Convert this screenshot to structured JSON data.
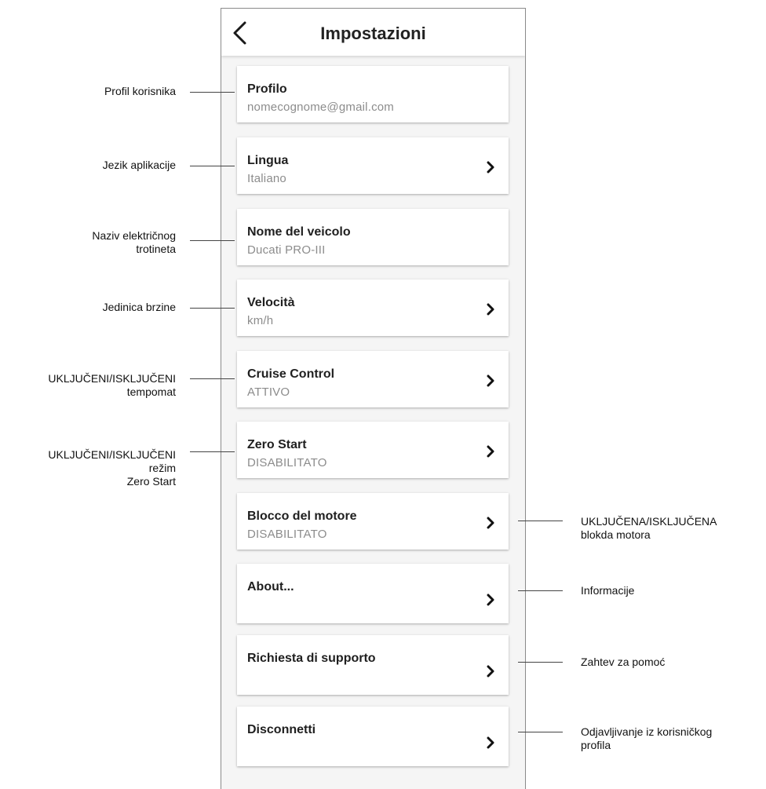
{
  "header": {
    "title": "Impostazioni"
  },
  "items": [
    {
      "title": "Profilo",
      "subtitle": "nomecognome@gmail.com",
      "chevron": false
    },
    {
      "title": "Lingua",
      "subtitle": "Italiano",
      "chevron": true
    },
    {
      "title": "Nome del veicolo",
      "subtitle": "Ducati PRO-III",
      "chevron": false
    },
    {
      "title": "Velocità",
      "subtitle": "km/h",
      "chevron": true
    },
    {
      "title": "Cruise Control",
      "subtitle": "ATTIVO",
      "chevron": true
    },
    {
      "title": "Zero Start",
      "subtitle": "DISABILITATO",
      "chevron": true
    },
    {
      "title": "Blocco del motore",
      "subtitle": "DISABILITATO",
      "chevron": true
    },
    {
      "title": "About...",
      "subtitle": "",
      "chevron": true
    },
    {
      "title": "Richiesta di supporto",
      "subtitle": "",
      "chevron": true
    },
    {
      "title": "Disconnetti",
      "subtitle": "",
      "chevron": true
    }
  ],
  "annotations": {
    "profile": [
      "Profil korisnika"
    ],
    "language": [
      "Jezik aplikacije"
    ],
    "vehicle_name": [
      "Naziv električnog",
      "trotineta"
    ],
    "speed_unit": [
      "Jedinica brzine"
    ],
    "cruise_control": [
      "UKLJUČENI/ISKLJUČENI",
      "tempomat"
    ],
    "zero_start": [
      "UKLJUČENI/ISKLJUČENI",
      "režim",
      "Zero Start"
    ],
    "motor_lock": [
      "UKLJUČENA/ISKLJUČENA",
      "blokda motora"
    ],
    "about": [
      "Informacije"
    ],
    "support": [
      "Zahtev za pomoć"
    ],
    "logout": [
      "Odjavljivanje iz korisničkog",
      "profila"
    ]
  },
  "icons": {
    "back": "chevron-left-icon",
    "item": "chevron-right-icon"
  }
}
